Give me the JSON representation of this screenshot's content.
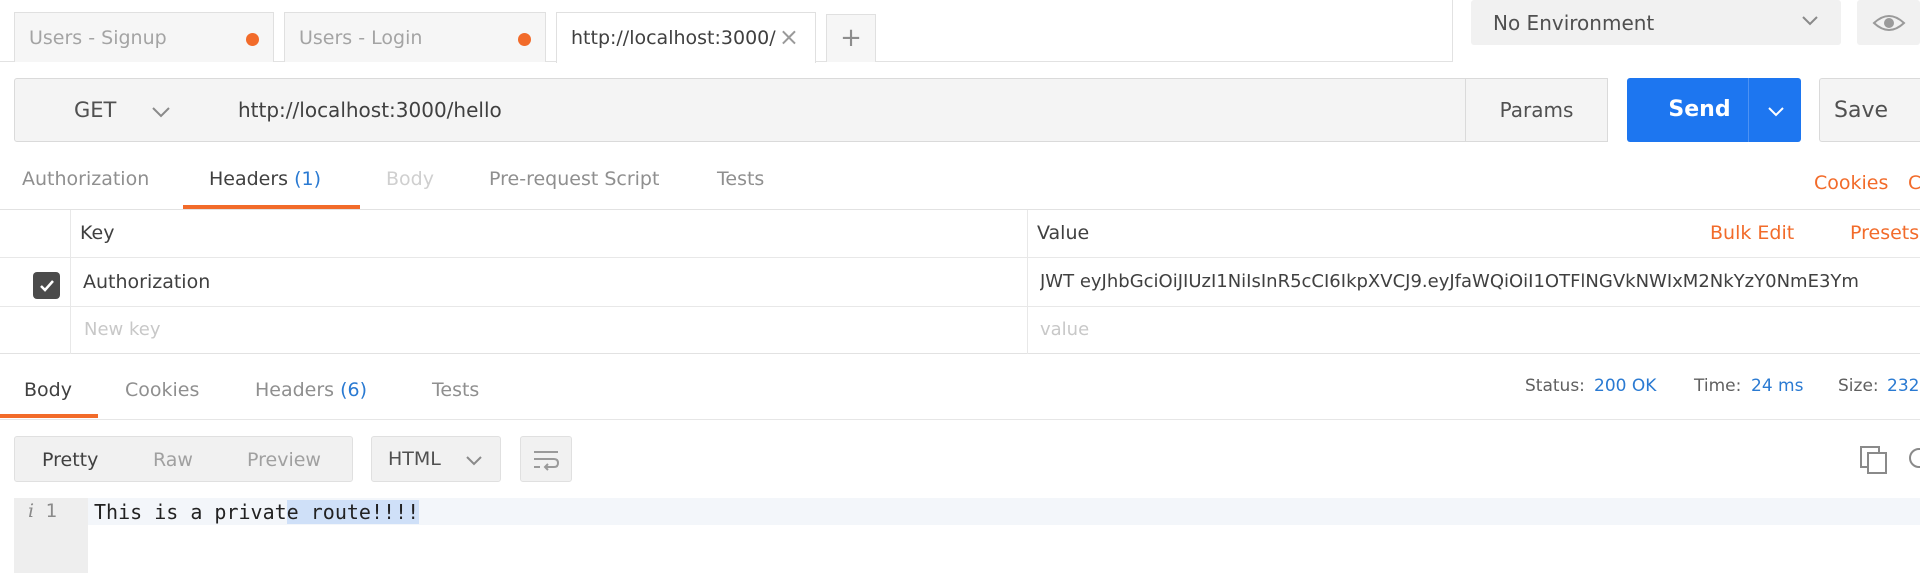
{
  "tabs": [
    {
      "label": "Users - Signup",
      "unsaved": true
    },
    {
      "label": "Users - Login",
      "unsaved": true
    },
    {
      "label": "http://localhost:3000/",
      "active": true
    }
  ],
  "new_tab_label": "+",
  "environment": {
    "selected": "No Environment"
  },
  "request": {
    "method": "GET",
    "url": "http://localhost:3000/hello",
    "params_label": "Params",
    "send_label": "Send",
    "save_label": "Save"
  },
  "request_tabs": {
    "authorization": "Authorization",
    "headers": "Headers",
    "headers_count": "(1)",
    "body": "Body",
    "prerequest": "Pre-request Script",
    "tests": "Tests",
    "cookies": "Cookies",
    "code_fragment": "C"
  },
  "headers_table": {
    "key_col": "Key",
    "value_col": "Value",
    "bulk_edit": "Bulk Edit",
    "presets": "Presets",
    "rows": [
      {
        "key": "Authorization",
        "value": "JWT eyJhbGciOiJIUzI1NiIsInR5cCI6IkpXVCJ9.eyJfaWQiOiI1OTFlNGVkNWIxM2NkYzY0NmE3Ym",
        "enabled": true
      }
    ],
    "new_key_placeholder": "New key",
    "new_value_placeholder": "value"
  },
  "response_tabs": {
    "body": "Body",
    "cookies": "Cookies",
    "headers": "Headers",
    "headers_count": "(6)",
    "tests": "Tests"
  },
  "status": {
    "status_label": "Status:",
    "status_value": "200 OK",
    "time_label": "Time:",
    "time_value": "24 ms",
    "size_label": "Size:",
    "size_value": "232"
  },
  "view_modes": {
    "pretty": "Pretty",
    "raw": "Raw",
    "preview": "Preview"
  },
  "format": {
    "selected": "HTML"
  },
  "body_lines": [
    {
      "number": "1",
      "text_before": "This is a privat",
      "text_selected": "e route!!!!"
    }
  ],
  "colors": {
    "accent": "#f26b2a",
    "send_blue": "#1d76f0",
    "link_blue": "#2a7ad2"
  },
  "icons": [
    "chevron-down-icon",
    "eye-icon",
    "close-icon",
    "checkmark-icon",
    "wrap-lines-icon",
    "copy-icon",
    "search-icon",
    "info-icon"
  ]
}
